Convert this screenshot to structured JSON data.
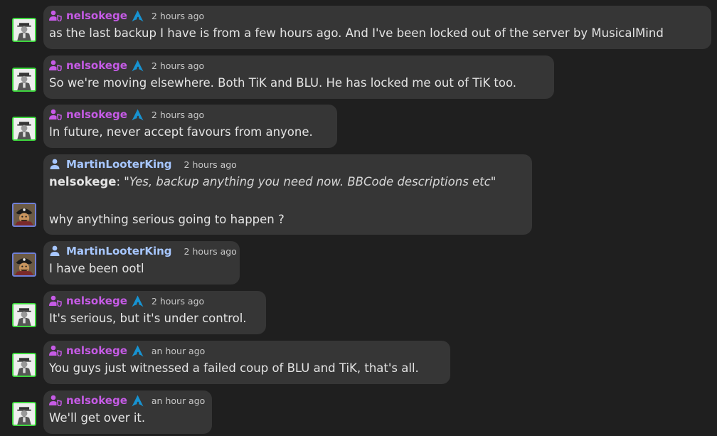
{
  "messages": [
    {
      "user": "nelsokege",
      "time": "2 hours ago",
      "text": "as the last backup I have is from a few hours ago. And I've been locked out of the server by MusicalMind"
    },
    {
      "user": "nelsokege",
      "time": "2 hours ago",
      "text": "So we're moving elsewhere. Both TiK and BLU. He has locked me out of TiK too."
    },
    {
      "user": "nelsokege",
      "time": "2 hours ago",
      "text": "In future, never accept favours from anyone."
    },
    {
      "user": "MartinLooterKing",
      "time": "2 hours ago",
      "quote_author": "nelsokege",
      "quote_sep": ": \"",
      "quote_text": "Yes, backup anything you need now. BBCode descriptions etc",
      "quote_end": "\"",
      "text": "why anything serious going to happen ?"
    },
    {
      "user": "MartinLooterKing",
      "time": "2 hours ago",
      "text": "I have been ootl"
    },
    {
      "user": "nelsokege",
      "time": "2 hours ago",
      "text": "It's serious, but it's under control."
    },
    {
      "user": "nelsokege",
      "time": "an hour ago",
      "text": "You guys just witnessed a failed coup of BLU and TiK, that's all."
    },
    {
      "user": "nelsokege",
      "time": "an hour ago",
      "text": "We'll get over it."
    }
  ],
  "colors": {
    "background": "#1f1f1f",
    "bubble": "#363636",
    "admin_name": "#c65be6",
    "member_name": "#a7c7ff",
    "timestamp": "#c8c8c8",
    "message_text": "#e4e4e4",
    "admin_avatar_border": "#3ed63e",
    "member_avatar_border": "#6e7fd8",
    "role_badge": "#1793d1"
  },
  "icons": {
    "admin_user": "user-shield-icon",
    "member_user": "user-icon",
    "role_badge": "arch-linux-icon",
    "admin_avatar": "man-in-hat-avatar",
    "member_avatar": "pirate-avatar"
  }
}
